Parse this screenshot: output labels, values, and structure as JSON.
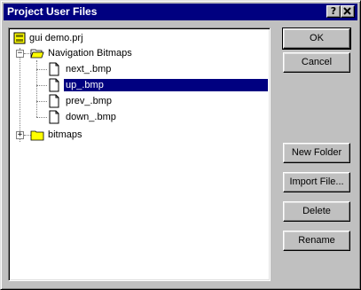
{
  "dialog": {
    "title": "Project User Files",
    "help_button": "?",
    "close_button": "✕"
  },
  "tree": {
    "items": [
      {
        "label": "gui demo.prj",
        "icon": "project-file-icon"
      },
      {
        "label": "Navigation Bitmaps",
        "icon": "open-folder-icon",
        "expander": "−"
      },
      {
        "label": "next_.bmp",
        "icon": "document-icon"
      },
      {
        "label": "up_.bmp",
        "icon": "document-icon",
        "selected": true
      },
      {
        "label": "prev_.bmp",
        "icon": "document-icon"
      },
      {
        "label": "down_.bmp",
        "icon": "document-icon"
      },
      {
        "label": "bitmaps",
        "icon": "folder-icon",
        "expander": "+"
      }
    ]
  },
  "buttons": {
    "ok": "OK",
    "cancel": "Cancel",
    "new_folder": "New Folder",
    "import_file": "Import File...",
    "delete": "Delete",
    "rename": "Rename"
  },
  "colors": {
    "title_bar": "#000080",
    "selection": "#000080",
    "face": "#c0c0c0",
    "folder": "#ffff00"
  }
}
